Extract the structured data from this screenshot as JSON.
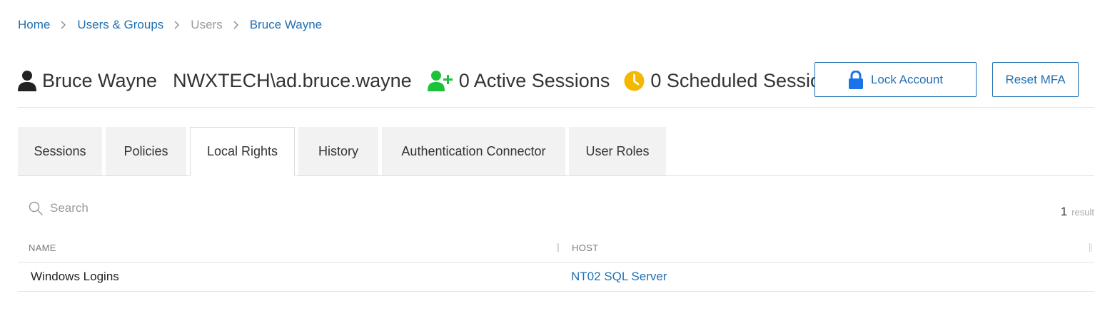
{
  "breadcrumb": {
    "items": [
      {
        "label": "Home"
      },
      {
        "label": "Users & Groups"
      },
      {
        "label": "Users"
      },
      {
        "label": "Bruce Wayne"
      }
    ]
  },
  "header": {
    "user_name": "Bruce Wayne",
    "user_login": "NWXTECH\\ad.bruce.wayne",
    "active_sessions": "0 Active Sessions",
    "scheduled_sessions": "0 Scheduled Sessions",
    "lock_account_label": "Lock Account",
    "reset_mfa_label": "Reset MFA",
    "icons": {
      "user": "user-icon",
      "active_sessions": "user-plus-icon",
      "scheduled_sessions": "clock-icon",
      "lock": "lock-icon"
    },
    "colors": {
      "accent": "#1f6fb2",
      "active_sessions_icon": "#1ec23a",
      "scheduled_icon": "#f5b800"
    }
  },
  "tabs": [
    {
      "label": "Sessions",
      "active": false
    },
    {
      "label": "Policies",
      "active": false
    },
    {
      "label": "Local Rights",
      "active": true
    },
    {
      "label": "History",
      "active": false
    },
    {
      "label": "Authentication Connector",
      "active": false
    },
    {
      "label": "User Roles",
      "active": false
    }
  ],
  "search": {
    "placeholder": "Search",
    "value": ""
  },
  "results": {
    "count": "1",
    "label": "result"
  },
  "table": {
    "columns": [
      "NAME",
      "HOST"
    ],
    "rows": [
      {
        "name": "Windows Logins",
        "host": "NT02 SQL Server"
      }
    ]
  }
}
